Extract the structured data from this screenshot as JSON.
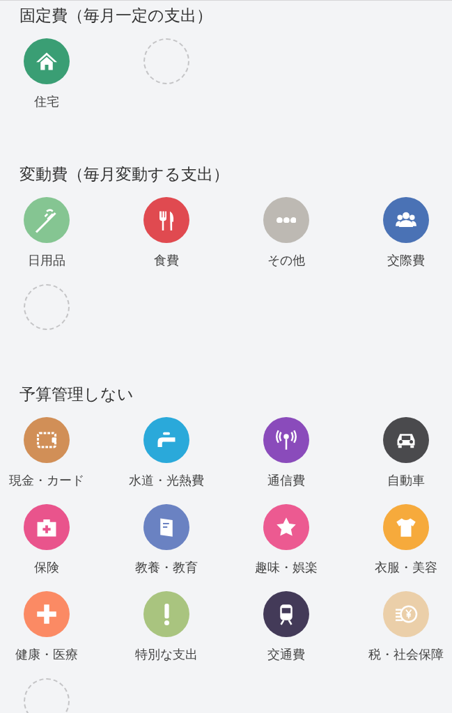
{
  "sections": [
    {
      "title": "固定費（毎月一定の支出）",
      "items": [
        {
          "kind": "category",
          "label": "住宅",
          "color": "#3a9e74"
        },
        {
          "kind": "empty"
        }
      ]
    },
    {
      "title": "変動費（毎月変動する支出）",
      "items": [
        {
          "kind": "category",
          "label": "日用品",
          "color": "#85c592"
        },
        {
          "kind": "category",
          "label": "食費",
          "color": "#e04a50"
        },
        {
          "kind": "category",
          "label": "その他",
          "color": "#bdb9b3"
        },
        {
          "kind": "category",
          "label": "交際費",
          "color": "#4a72b5"
        },
        {
          "kind": "empty"
        }
      ]
    },
    {
      "title": "予算管理しない",
      "items": [
        {
          "kind": "category",
          "label": "現金・カード",
          "color": "#d18f57"
        },
        {
          "kind": "category",
          "label": "水道・光熱費",
          "color": "#2aa9da"
        },
        {
          "kind": "category",
          "label": "通信費",
          "color": "#8a4bbb"
        },
        {
          "kind": "category",
          "label": "自動車",
          "color": "#4a4a4d"
        },
        {
          "kind": "category",
          "label": "保険",
          "color": "#e9548c"
        },
        {
          "kind": "category",
          "label": "教養・教育",
          "color": "#6a82c2"
        },
        {
          "kind": "category",
          "label": "趣味・娯楽",
          "color": "#ec5a91"
        },
        {
          "kind": "category",
          "label": "衣服・美容",
          "color": "#f6aa3c"
        },
        {
          "kind": "category",
          "label": "健康・医療",
          "color": "#fb8a64"
        },
        {
          "kind": "category",
          "label": "特別な支出",
          "color": "#a9c47f"
        },
        {
          "kind": "category",
          "label": "交通費",
          "color": "#433a58"
        },
        {
          "kind": "category",
          "label": "税・社会保障",
          "color": "#ebcfa9"
        },
        {
          "kind": "empty"
        }
      ]
    }
  ]
}
